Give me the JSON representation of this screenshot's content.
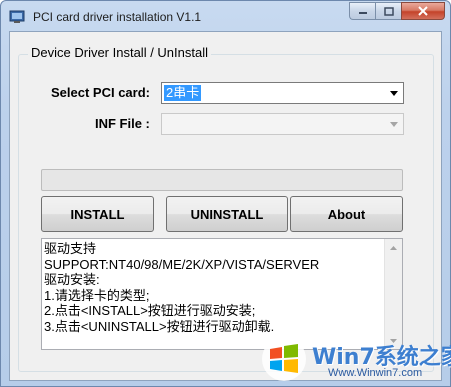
{
  "window": {
    "title": "PCI card driver installation V1.1"
  },
  "group": {
    "title": "Device Driver Install / UnInstall"
  },
  "form": {
    "pci_label": "Select PCI card:",
    "pci_value": "2串卡",
    "inf_label": "INF File :",
    "inf_value": ""
  },
  "progress": {
    "value": 0
  },
  "buttons": {
    "install": "INSTALL",
    "uninstall": "UNINSTALL",
    "about": "About"
  },
  "info_lines": [
    "驱动支持",
    "SUPPORT:NT40/98/ME/2K/XP/VISTA/SERVER",
    "驱动安装:",
    "1.请选择卡的类型;",
    "2.点击<INSTALL>按钮进行驱动安装;",
    "3.点击<UNINSTALL>按钮进行驱动卸载."
  ],
  "watermark": {
    "brand": "Win7系统之家",
    "url": "Www.Winwin7.com"
  },
  "icons": {
    "app": "app-icon",
    "minimize": "minimize-icon",
    "maximize": "maximize-icon",
    "close": "close-icon",
    "dropdown": "chevron-down-icon",
    "scroll_up": "scroll-up-icon",
    "scroll_down": "scroll-down-icon",
    "logo": "windows-logo-icon"
  },
  "colors": {
    "selection": "#3399ff",
    "close_button": "#c4432a",
    "watermark_text": "#3d7fd0"
  }
}
